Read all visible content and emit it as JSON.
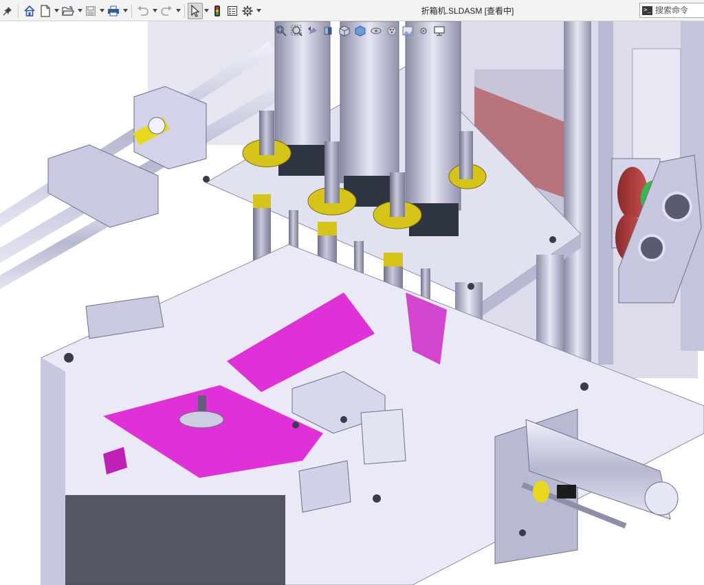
{
  "window": {
    "title": "折箱机.SLDASM [查看中]"
  },
  "toolbar": {
    "items": [
      {
        "name": "pin-icon",
        "interactable": true,
        "caret": false
      },
      {
        "name": "home-icon",
        "interactable": true,
        "caret": false
      },
      {
        "name": "new-document-icon",
        "interactable": true,
        "caret": true
      },
      {
        "name": "open-folder-icon",
        "interactable": true,
        "caret": true
      },
      {
        "name": "save-icon",
        "interactable": true,
        "caret": true
      },
      {
        "name": "print-icon",
        "interactable": true,
        "caret": true
      },
      {
        "name": "undo-icon",
        "interactable": true,
        "caret": true
      },
      {
        "name": "redo-icon",
        "interactable": true,
        "caret": true
      },
      {
        "name": "select-pointer-icon",
        "interactable": true,
        "caret": true
      },
      {
        "name": "traffic-light-icon",
        "interactable": true,
        "caret": false
      },
      {
        "name": "file-properties-icon",
        "interactable": true,
        "caret": false
      },
      {
        "name": "gear-icon",
        "interactable": true,
        "caret": true
      }
    ]
  },
  "search": {
    "placeholder": "搜索命令"
  },
  "hud": {
    "items": [
      "zoom-to-fit-icon",
      "zoom-area-icon",
      "previous-view-icon",
      "section-view-icon",
      "view-orientation-icon",
      "display-style-icon",
      "hide-show-icon",
      "appearance-icon",
      "scene-icon",
      "view-settings-icon",
      "monitor-icon"
    ]
  },
  "colors": {
    "accent_magenta": "#e030d8",
    "accent_yellow": "#d6c419",
    "accent_red": "#b03030",
    "accent_green": "#38b848",
    "metal_light": "#d5d6ec",
    "metal_mid": "#a8aac4",
    "metal_dark": "#5e6078",
    "toolbar_bg": "#f3f3f3"
  }
}
